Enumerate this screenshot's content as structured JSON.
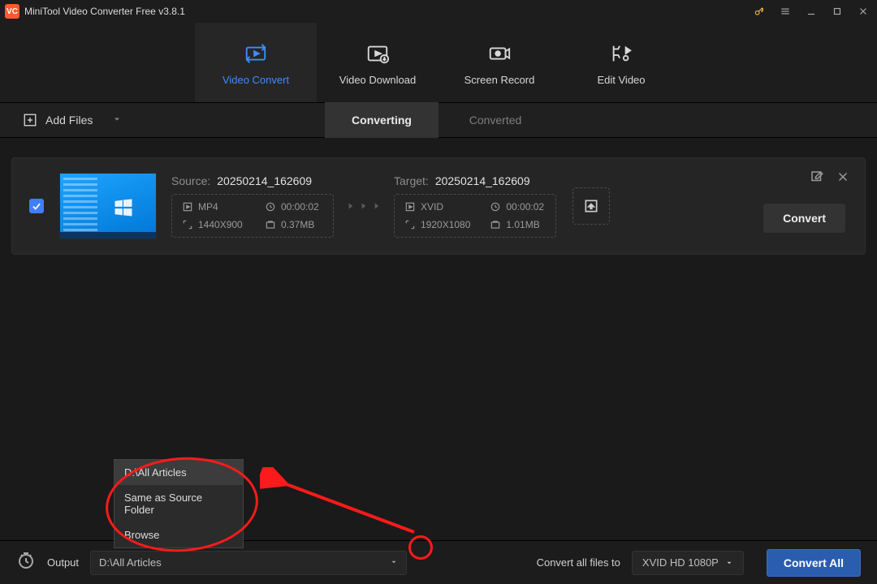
{
  "title": "MiniTool Video Converter Free v3.8.1",
  "tabs": {
    "convert": "Video Convert",
    "download": "Video Download",
    "record": "Screen Record",
    "edit": "Edit Video"
  },
  "toolbar": {
    "add_files": "Add Files",
    "converting": "Converting",
    "converted": "Converted"
  },
  "item": {
    "source_label": "Source:",
    "source_file": "20250214_162609",
    "source_meta": {
      "format": "MP4",
      "duration": "00:00:02",
      "resolution": "1440X900",
      "size": "0.37MB"
    },
    "target_label": "Target:",
    "target_file": "20250214_162609",
    "target_meta": {
      "format": "XVID",
      "duration": "00:00:02",
      "resolution": "1920X1080",
      "size": "1.01MB"
    },
    "convert_btn": "Convert"
  },
  "output_menu": {
    "opt1": "D:\\All Articles",
    "opt2": "Same as Source Folder",
    "opt3": "Browse"
  },
  "bottom": {
    "output_label": "Output",
    "output_value": "D:\\All Articles",
    "convert_to_label": "Convert all files to",
    "format_value": "XVID HD 1080P",
    "convert_all": "Convert All"
  }
}
